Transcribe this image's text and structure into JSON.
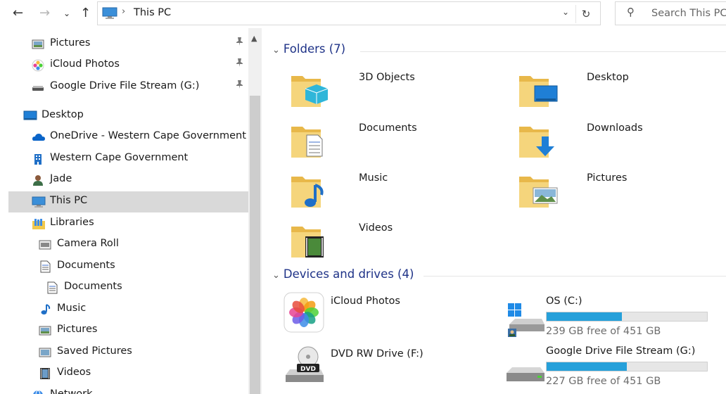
{
  "address": {
    "path": "This PC",
    "search_placeholder": "Search This PC"
  },
  "nav": {
    "items": [
      {
        "label": "Pictures",
        "icon": "pictures-icon",
        "pinned": true
      },
      {
        "label": "iCloud Photos",
        "icon": "icloud-photos-icon",
        "pinned": true
      },
      {
        "label": "Google Drive File Stream (G:)",
        "icon": "drive-icon",
        "pinned": true
      },
      {
        "label": "Desktop",
        "icon": "desktop-icon"
      },
      {
        "label": "OneDrive - Western Cape Government",
        "icon": "onedrive-icon"
      },
      {
        "label": "Western Cape Government",
        "icon": "building-icon"
      },
      {
        "label": "Jade",
        "icon": "user-icon"
      },
      {
        "label": "This PC",
        "icon": "this-pc-icon",
        "selected": true
      },
      {
        "label": "Libraries",
        "icon": "libraries-icon"
      },
      {
        "label": "Camera Roll",
        "icon": "camera-roll-icon"
      },
      {
        "label": "Documents",
        "icon": "documents-icon"
      },
      {
        "label": "Documents",
        "icon": "documents-icon"
      },
      {
        "label": "Music",
        "icon": "music-icon"
      },
      {
        "label": "Pictures",
        "icon": "pictures-icon"
      },
      {
        "label": "Saved Pictures",
        "icon": "saved-pictures-icon"
      },
      {
        "label": "Videos",
        "icon": "videos-icon"
      },
      {
        "label": "Network",
        "icon": "network-icon"
      }
    ]
  },
  "content": {
    "folders_header": "Folders (7)",
    "folders": [
      {
        "label": "3D Objects",
        "icon": "3d-objects-folder-icon"
      },
      {
        "label": "Desktop",
        "icon": "desktop-folder-icon"
      },
      {
        "label": "Documents",
        "icon": "documents-folder-icon"
      },
      {
        "label": "Downloads",
        "icon": "downloads-folder-icon"
      },
      {
        "label": "Music",
        "icon": "music-folder-icon"
      },
      {
        "label": "Pictures",
        "icon": "pictures-folder-icon"
      },
      {
        "label": "Videos",
        "icon": "videos-folder-icon"
      }
    ],
    "devices_header": "Devices and drives (4)",
    "devices": [
      {
        "label": "iCloud Photos",
        "icon": "icloud-photos-icon"
      },
      {
        "label": "OS (C:)",
        "icon": "os-drive-icon",
        "free_text": "239 GB free of 451 GB",
        "used_fraction": 0.47
      },
      {
        "label": "DVD RW Drive (F:)",
        "icon": "dvd-drive-icon"
      },
      {
        "label": "Google Drive File Stream (G:)",
        "icon": "network-drive-icon",
        "free_text": "227 GB free of 451 GB",
        "used_fraction": 0.5
      }
    ]
  },
  "colors": {
    "accent": "#1e3287",
    "drive_fill": "#26a0da",
    "selection": "#d9d9d9",
    "folder": "#f5d57c"
  }
}
